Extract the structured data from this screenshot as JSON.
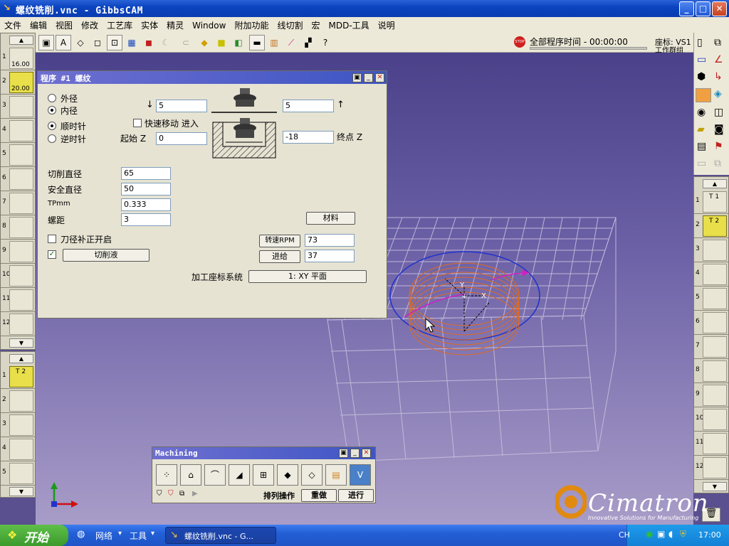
{
  "window": {
    "title": "螺纹铣削.vnc - GibbsCAM",
    "min": "_",
    "max": "□",
    "close": "✕"
  },
  "menu": [
    "文件",
    "编辑",
    "视图",
    "修改",
    "工艺库",
    "实体",
    "精灵",
    "Window",
    "附加功能",
    "线切割",
    "宏",
    "MDD-工具",
    "说明"
  ],
  "status": {
    "stop": "STOP",
    "time_label": "全部程序时间 - 00:00:00",
    "coord_label": "座标: VS1",
    "workgroup": "工作群组"
  },
  "left_tools": {
    "slot1_num": "1",
    "slot1_val": "16.00",
    "slot2_num": "2",
    "slot2_val": "20.00",
    "nums": [
      "3",
      "4",
      "5",
      "6",
      "7",
      "8",
      "9",
      "10",
      "11",
      "12"
    ]
  },
  "left_ops": {
    "slot1_num": "1",
    "slot1_tag": "T 2",
    "nums": [
      "2",
      "3",
      "4",
      "5"
    ]
  },
  "right_ops": {
    "slot1_num": "1",
    "slot1_tag": "T 1",
    "slot2_num": "2",
    "slot2_tag": "T 2",
    "nums": [
      "3",
      "4",
      "5",
      "6",
      "7",
      "8",
      "9",
      "10",
      "11",
      "12"
    ]
  },
  "dialog": {
    "title": "程序 #1 螺纹",
    "outer_label": "外径",
    "inner_label": "内径",
    "cw_label": "顺时针",
    "ccw_label": "逆时针",
    "rapid_label": "快速移动 进入",
    "start_z_label": "起始 Z",
    "end_z_label": "终点 Z",
    "down_val": "5",
    "up_val": "5",
    "start_z": "0",
    "end_z": "-18",
    "cut_dia_label": "切削直径",
    "cut_dia": "65",
    "safe_dia_label": "安全直径",
    "safe_dia": "50",
    "tpmm_label": "TPmm",
    "tpmm": "0.333",
    "pitch_label": "螺距",
    "pitch": "3",
    "material_btn": "材料",
    "comp_label": "刀径补正开启",
    "coolant_btn": "切削液",
    "rpm_btn": "转速RPM",
    "rpm": "73",
    "feed_btn": "进给",
    "feed": "37",
    "coord_label": "加工座标系统",
    "coord_btn": "1: XY 平面"
  },
  "machining": {
    "title": "Machining",
    "sort_label": "排列操作",
    "redo_btn": "重做",
    "run_btn": "进行"
  },
  "brand": {
    "name": "Cimatron",
    "tagline": "Innovative Solutions for Manufacturing"
  },
  "taskbar": {
    "start": "开始",
    "network": "网络",
    "tools": "工具",
    "task": "螺纹铣削.vnc - G...",
    "lang": "CH",
    "clock": "17:00"
  },
  "colors": {
    "accent": "#3e55c4",
    "selected": "#e8df4a",
    "toolpath": "#e06a20"
  }
}
